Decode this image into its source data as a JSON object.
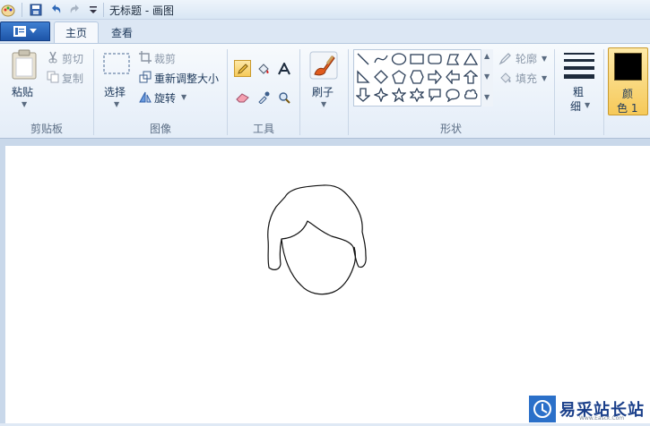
{
  "window": {
    "title": "无标题 - 画图"
  },
  "tabs": [
    {
      "label": "主页"
    },
    {
      "label": "查看"
    }
  ],
  "ribbon": {
    "clipboard": {
      "label": "剪贴板",
      "paste": "粘贴",
      "cut": "剪切",
      "copy": "复制"
    },
    "image": {
      "label": "图像",
      "select": "选择",
      "crop": "裁剪",
      "resize": "重新调整大小",
      "rotate": "旋转"
    },
    "tools": {
      "label": "工具"
    },
    "brush": {
      "label": "刷子"
    },
    "shapes": {
      "label": "形状",
      "outline": "轮廓",
      "fill": "填充"
    },
    "size": {
      "line1": "粗",
      "line2": "细"
    },
    "color": {
      "line1": "颜",
      "line2": "色 1",
      "value": "#000000"
    }
  },
  "watermark": {
    "text": "易采站长站",
    "sub": "Www.Easck.Com"
  },
  "colors": {
    "accent": "#1d55a8",
    "highlight": "#f6c959"
  }
}
